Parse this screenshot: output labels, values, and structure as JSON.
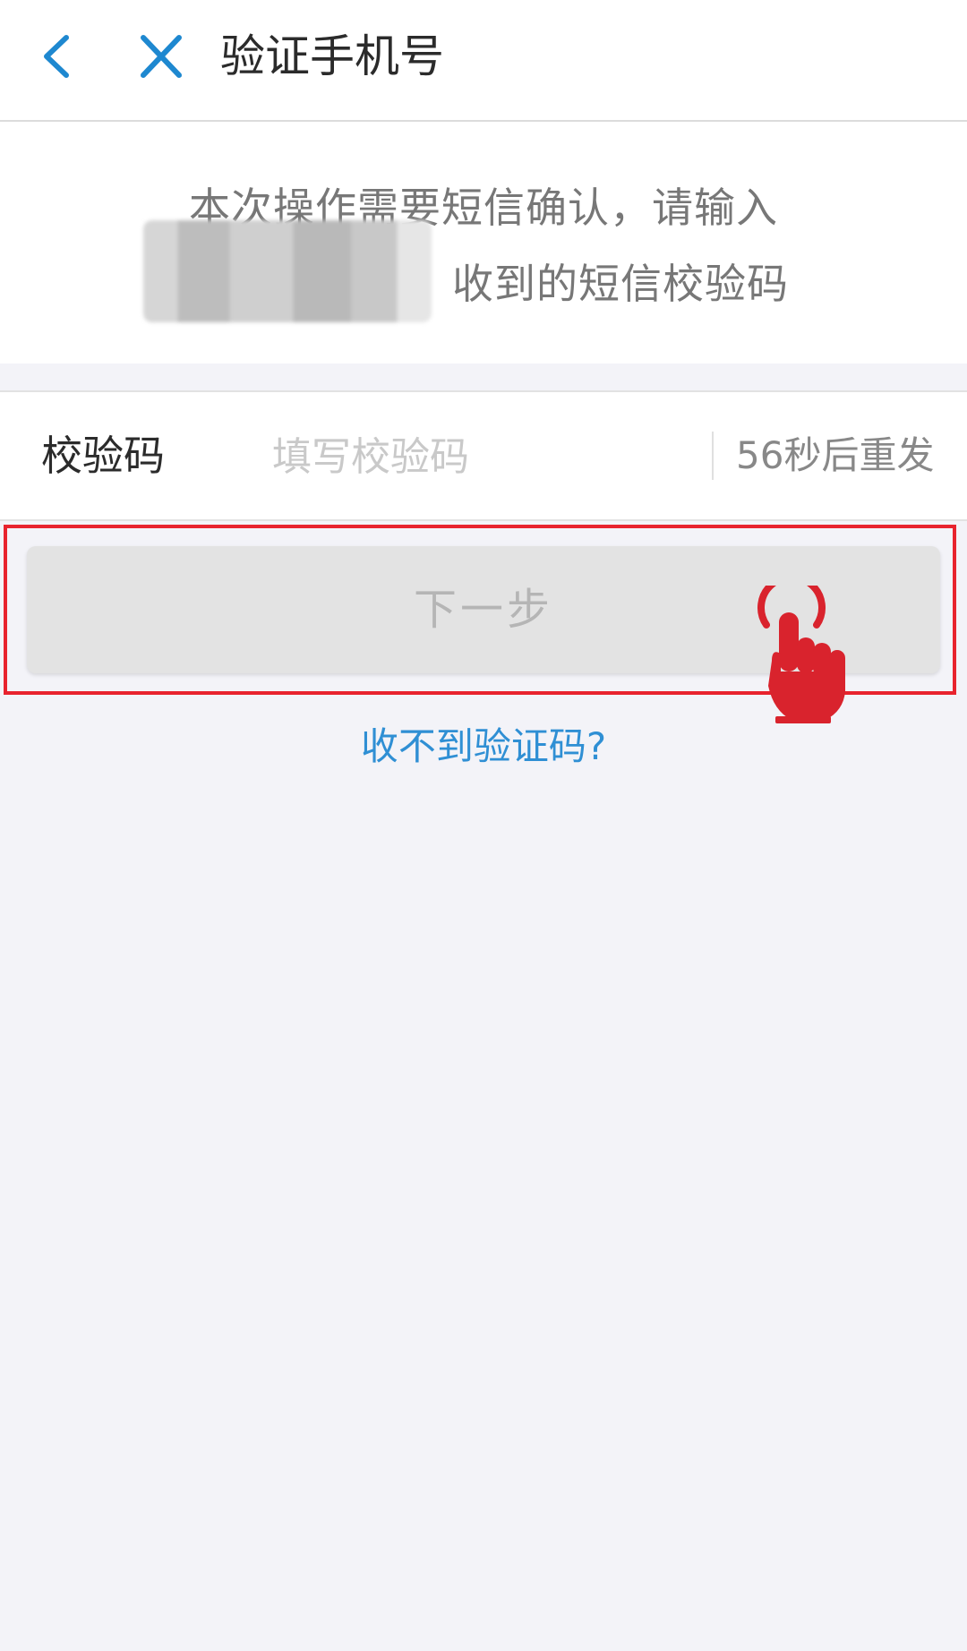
{
  "header": {
    "back_icon": "chevron-left-icon",
    "close_icon": "close-icon",
    "title": "验证手机号",
    "accent_color": "#1e88d0"
  },
  "notice": {
    "line1": "本次操作需要短信确认，请输入",
    "line2": "收到的短信校验码"
  },
  "code_field": {
    "label": "校验码",
    "placeholder": "填写校验码",
    "value": "",
    "resend_text": "56秒后重发"
  },
  "next_button": {
    "label": "下一步"
  },
  "help_link": "收不到验证码?",
  "annotation": {
    "highlight_color": "#e8232e",
    "pointer_icon": "tap-hand-icon"
  }
}
